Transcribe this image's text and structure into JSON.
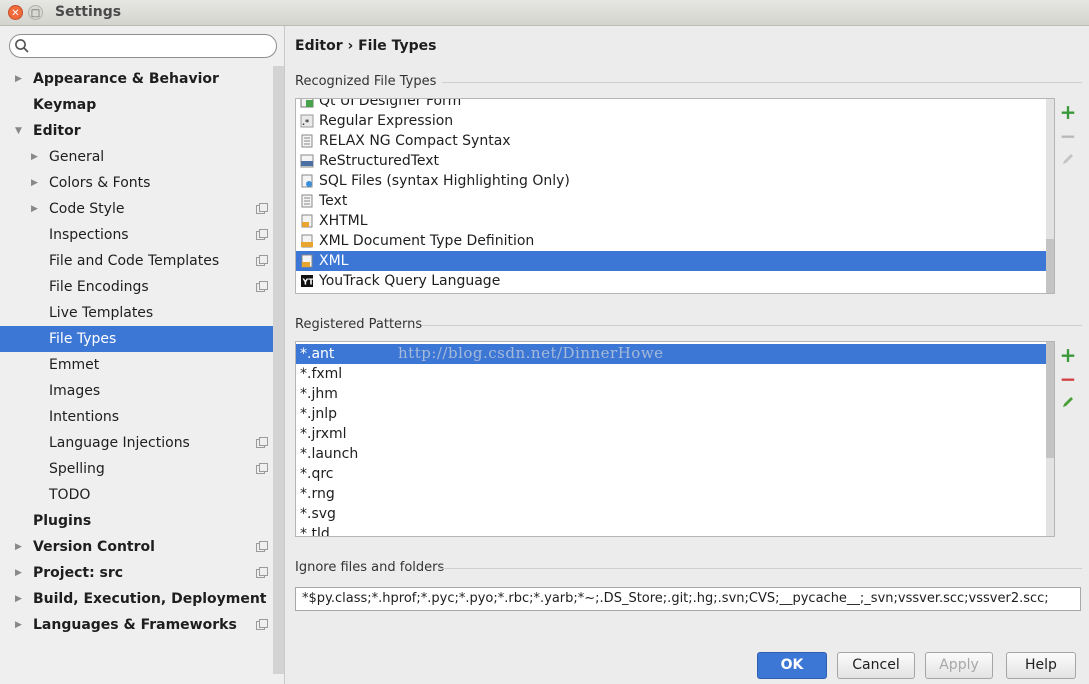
{
  "window": {
    "title": "Settings"
  },
  "search": {
    "placeholder": ""
  },
  "sidebar": {
    "items": [
      {
        "label": "Appearance & Behavior",
        "level": 0,
        "bold": true,
        "arrow": "collapsed",
        "proj": false,
        "selected": false
      },
      {
        "label": "Keymap",
        "level": 0,
        "bold": true,
        "arrow": "none",
        "proj": false,
        "selected": false
      },
      {
        "label": "Editor",
        "level": 0,
        "bold": true,
        "arrow": "expanded",
        "proj": false,
        "selected": false
      },
      {
        "label": "General",
        "level": 1,
        "bold": false,
        "arrow": "collapsed",
        "proj": false,
        "selected": false
      },
      {
        "label": "Colors & Fonts",
        "level": 1,
        "bold": false,
        "arrow": "collapsed",
        "proj": false,
        "selected": false
      },
      {
        "label": "Code Style",
        "level": 1,
        "bold": false,
        "arrow": "collapsed",
        "proj": true,
        "selected": false
      },
      {
        "label": "Inspections",
        "level": 1,
        "bold": false,
        "arrow": "none",
        "proj": true,
        "selected": false
      },
      {
        "label": "File and Code Templates",
        "level": 1,
        "bold": false,
        "arrow": "none",
        "proj": true,
        "selected": false
      },
      {
        "label": "File Encodings",
        "level": 1,
        "bold": false,
        "arrow": "none",
        "proj": true,
        "selected": false
      },
      {
        "label": "Live Templates",
        "level": 1,
        "bold": false,
        "arrow": "none",
        "proj": false,
        "selected": false
      },
      {
        "label": "File Types",
        "level": 1,
        "bold": false,
        "arrow": "none",
        "proj": false,
        "selected": true
      },
      {
        "label": "Emmet",
        "level": 1,
        "bold": false,
        "arrow": "none",
        "proj": false,
        "selected": false
      },
      {
        "label": "Images",
        "level": 1,
        "bold": false,
        "arrow": "none",
        "proj": false,
        "selected": false
      },
      {
        "label": "Intentions",
        "level": 1,
        "bold": false,
        "arrow": "none",
        "proj": false,
        "selected": false
      },
      {
        "label": "Language Injections",
        "level": 1,
        "bold": false,
        "arrow": "none",
        "proj": true,
        "selected": false
      },
      {
        "label": "Spelling",
        "level": 1,
        "bold": false,
        "arrow": "none",
        "proj": true,
        "selected": false
      },
      {
        "label": "TODO",
        "level": 1,
        "bold": false,
        "arrow": "none",
        "proj": false,
        "selected": false
      },
      {
        "label": "Plugins",
        "level": 0,
        "bold": true,
        "arrow": "none",
        "proj": false,
        "selected": false
      },
      {
        "label": "Version Control",
        "level": 0,
        "bold": true,
        "arrow": "collapsed",
        "proj": true,
        "selected": false
      },
      {
        "label": "Project: src",
        "level": 0,
        "bold": true,
        "arrow": "collapsed",
        "proj": true,
        "selected": false
      },
      {
        "label": "Build, Execution, Deployment",
        "level": 0,
        "bold": true,
        "arrow": "collapsed",
        "proj": false,
        "selected": false
      },
      {
        "label": "Languages & Frameworks",
        "level": 0,
        "bold": true,
        "arrow": "collapsed",
        "proj": true,
        "selected": false
      }
    ]
  },
  "main": {
    "breadcrumb": "Editor › File Types",
    "recognized": {
      "title": "Recognized File Types",
      "items": [
        {
          "label": "Qt UI Designer Form",
          "icon": "qt-form-icon",
          "selected": false
        },
        {
          "label": "Regular Expression",
          "icon": "regex-icon",
          "selected": false
        },
        {
          "label": "RELAX NG Compact Syntax",
          "icon": "text-file-icon",
          "selected": false
        },
        {
          "label": "ReStructuredText",
          "icon": "rst-icon",
          "selected": false
        },
        {
          "label": "SQL Files (syntax Highlighting Only)",
          "icon": "sql-icon",
          "selected": false
        },
        {
          "label": "Text",
          "icon": "text-file-icon",
          "selected": false
        },
        {
          "label": "XHTML",
          "icon": "xhtml-icon",
          "selected": false
        },
        {
          "label": "XML Document Type Definition",
          "icon": "dtd-icon",
          "selected": false
        },
        {
          "label": "XML",
          "icon": "xml-icon",
          "selected": true
        },
        {
          "label": "YouTrack Query Language",
          "icon": "youtrack-icon",
          "selected": false
        }
      ]
    },
    "patterns": {
      "title": "Registered Patterns",
      "items": [
        {
          "label": "*.ant",
          "selected": true
        },
        {
          "label": "*.fxml",
          "selected": false
        },
        {
          "label": "*.jhm",
          "selected": false
        },
        {
          "label": "*.jnlp",
          "selected": false
        },
        {
          "label": "*.jrxml",
          "selected": false
        },
        {
          "label": "*.launch",
          "selected": false
        },
        {
          "label": "*.qrc",
          "selected": false
        },
        {
          "label": "*.rng",
          "selected": false
        },
        {
          "label": "*.svg",
          "selected": false
        },
        {
          "label": "*.tld",
          "selected": false
        }
      ]
    },
    "ignore": {
      "title": "Ignore files and folders",
      "value": "*$py.class;*.hprof;*.pyc;*.pyo;*.rbc;*.yarb;*~;.DS_Store;.git;.hg;.svn;CVS;__pycache__;_svn;vssver.scc;vssver2.scc;"
    },
    "watermark": "http://blog.csdn.net/DinnerHowe"
  },
  "footer": {
    "ok": "OK",
    "cancel": "Cancel",
    "apply": "Apply",
    "help": "Help"
  },
  "colors": {
    "selection": "#3d77d6",
    "add_green": "#3a9a3a",
    "remove_red": "#d04040"
  }
}
